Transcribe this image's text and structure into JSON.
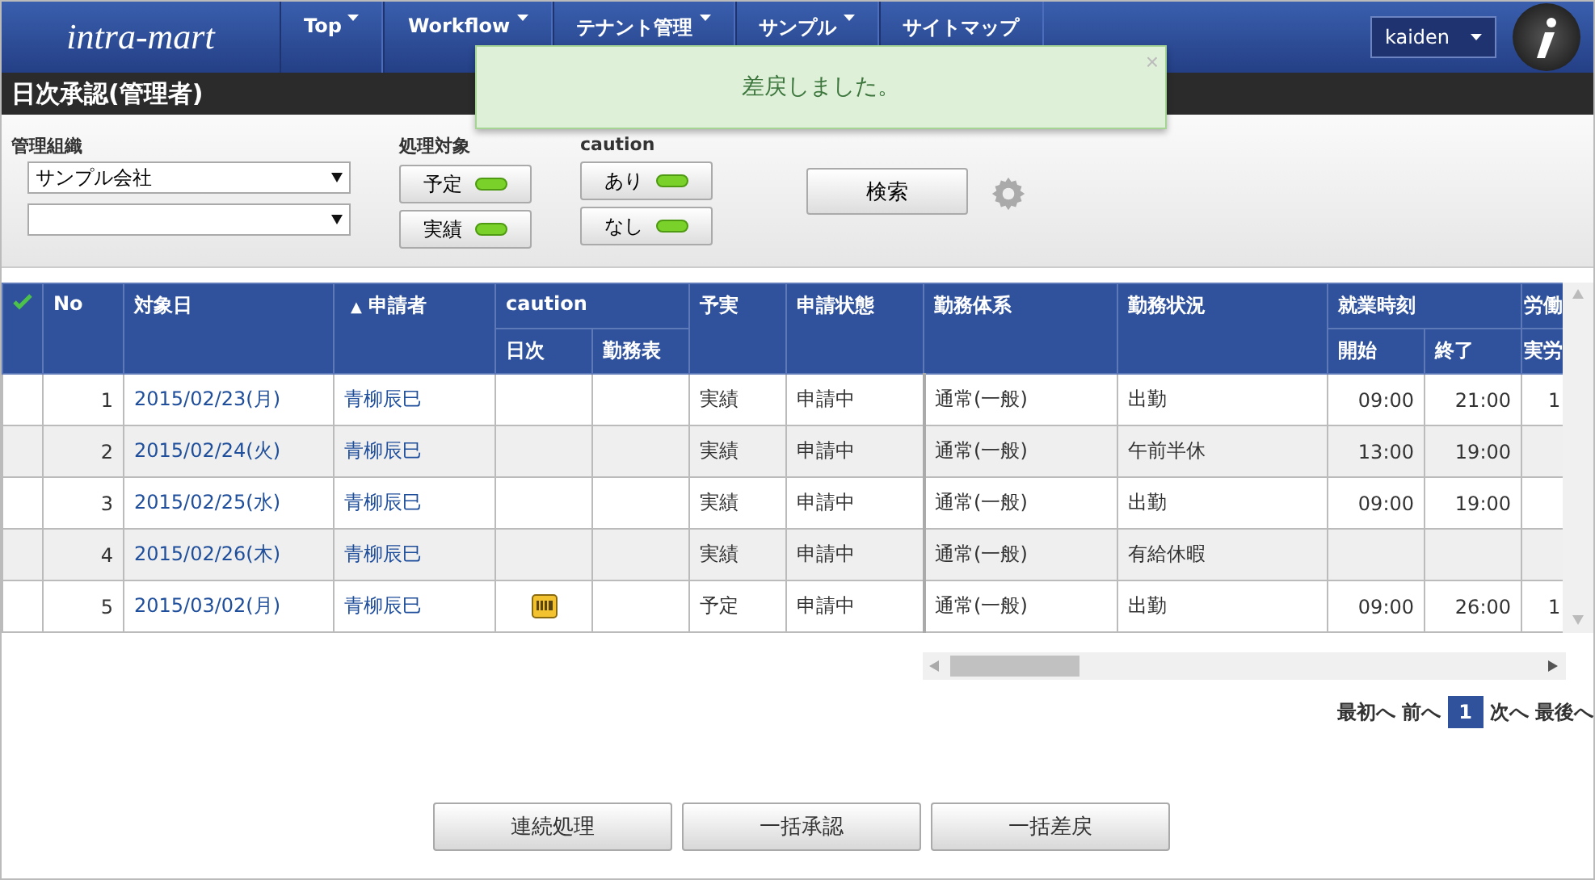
{
  "header": {
    "logo": "intra-mart",
    "nav": [
      {
        "label": "Top",
        "kind": "menu"
      },
      {
        "label": "Workflow",
        "kind": "menu"
      },
      {
        "label": "テナント管理",
        "kind": "menu"
      },
      {
        "label": "サンプル",
        "kind": "menu"
      },
      {
        "label": "サイトマップ",
        "kind": "link"
      }
    ],
    "user": "kaiden"
  },
  "page_title": "日次承認(管理者)",
  "toast": {
    "message": "差戻しました。",
    "close": "×"
  },
  "filters": {
    "org_label": "管理組織",
    "org_selects": [
      {
        "kind": "filled",
        "value": "サンプル会社"
      },
      {
        "kind": "empty"
      }
    ],
    "groups": [
      {
        "label": "処理対象",
        "toggles": [
          {
            "label": "予定",
            "on": true
          },
          {
            "label": "実績",
            "on": true
          }
        ]
      },
      {
        "label": "caution",
        "toggles": [
          {
            "label": "あり",
            "on": true
          },
          {
            "label": "なし",
            "on": true
          }
        ]
      }
    ],
    "search_button": "検索"
  },
  "table": {
    "columns": {
      "no": "No",
      "date": "対象日",
      "applicant": "申請者",
      "sort_mark": "▲",
      "caution": "caution",
      "daily": "日次",
      "timesheet": "勤務表",
      "plan_actual": "予実",
      "status": "申請状態",
      "work_system": "勤務体系",
      "work_status": "勤務状況",
      "work_time": "就業時刻",
      "start": "開始",
      "end": "終了",
      "labor": "労働",
      "actual": "実労"
    },
    "rows": [
      {
        "no": "1",
        "date": "2015/02/23(月)",
        "applicant": "青柳辰巳",
        "daily_caution": false,
        "plan_actual": "実績",
        "status": "申請中",
        "work_system": "通常(一般)",
        "work_status": "出勤",
        "start": "09:00",
        "end": "21:00",
        "actual": "1"
      },
      {
        "no": "2",
        "date": "2015/02/24(火)",
        "applicant": "青柳辰巳",
        "daily_caution": false,
        "plan_actual": "実績",
        "status": "申請中",
        "work_system": "通常(一般)",
        "work_status": "午前半休",
        "start": "13:00",
        "end": "19:00"
      },
      {
        "no": "3",
        "date": "2015/02/25(水)",
        "applicant": "青柳辰巳",
        "daily_caution": false,
        "plan_actual": "実績",
        "status": "申請中",
        "work_system": "通常(一般)",
        "work_status": "出勤",
        "start": "09:00",
        "end": "19:00"
      },
      {
        "no": "4",
        "date": "2015/02/26(木)",
        "applicant": "青柳辰巳",
        "daily_caution": false,
        "plan_actual": "実績",
        "status": "申請中",
        "work_system": "通常(一般)",
        "work_status": "有給休暇"
      },
      {
        "no": "5",
        "date": "2015/03/02(月)",
        "applicant": "青柳辰巳",
        "daily_caution": true,
        "plan_actual": "予定",
        "status": "申請中",
        "work_system": "通常(一般)",
        "work_status": "出勤",
        "start": "09:00",
        "end": "26:00",
        "actual": "1"
      }
    ]
  },
  "pagination": {
    "first": "最初へ",
    "prev": "前へ",
    "pages": [
      {
        "label": "1",
        "selected": true
      }
    ],
    "next": "次へ",
    "last": "最後へ"
  },
  "actions": [
    "連続処理",
    "一括承認",
    "一括差戻"
  ]
}
